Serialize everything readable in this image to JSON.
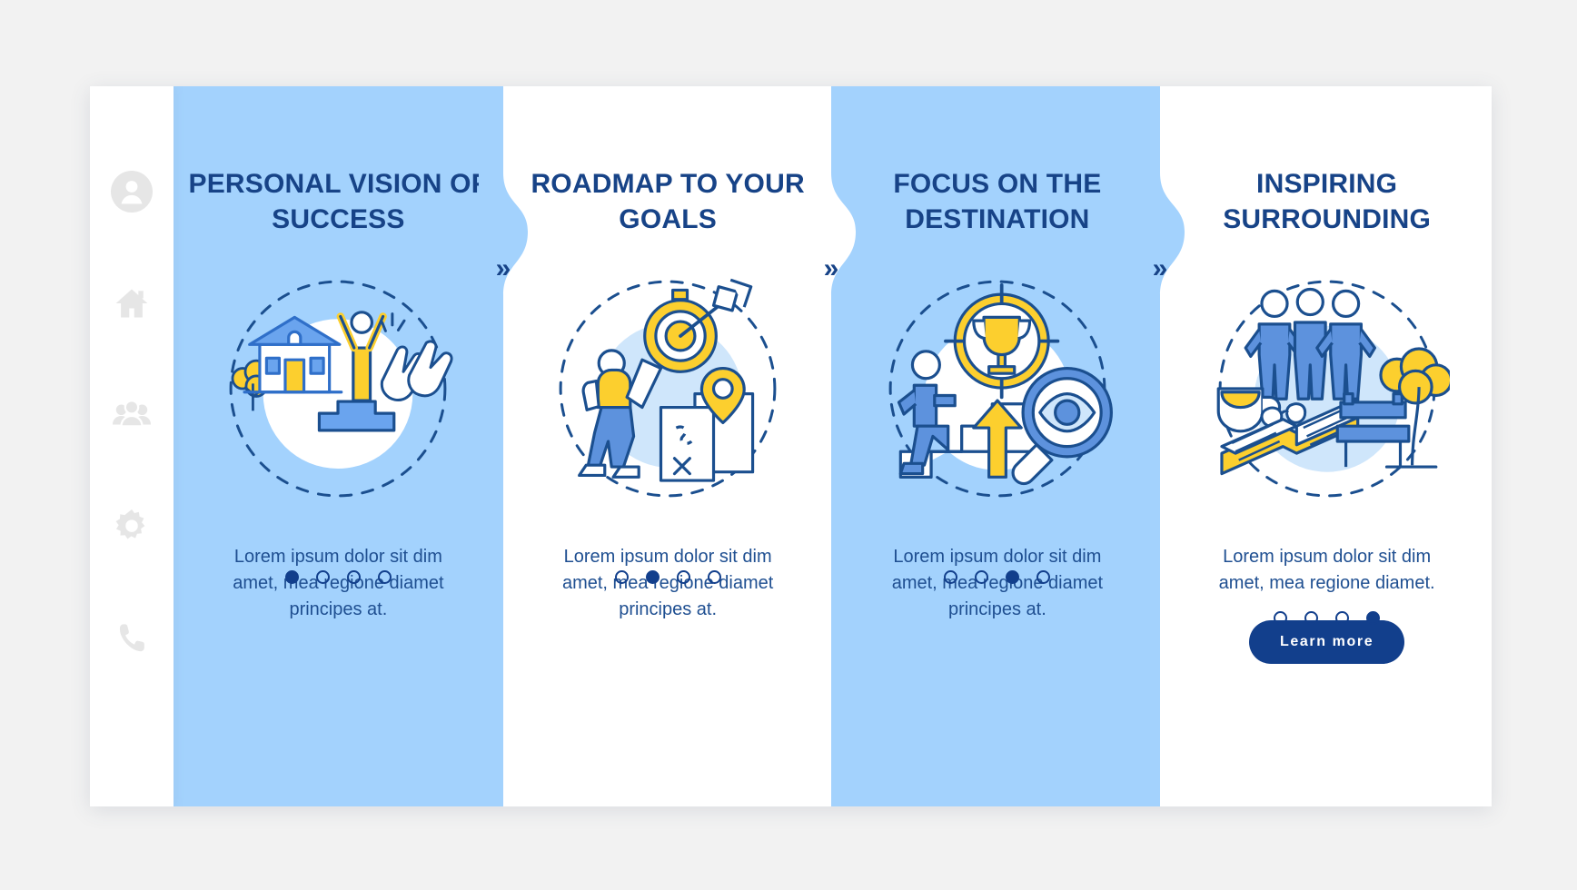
{
  "sidebar": {
    "items": [
      {
        "icon": "user-circle-icon",
        "name": "profile"
      },
      {
        "icon": "home-icon",
        "name": "home"
      },
      {
        "icon": "people-group-icon",
        "name": "community"
      },
      {
        "icon": "gear-icon",
        "name": "settings"
      },
      {
        "icon": "phone-icon",
        "name": "contact"
      }
    ]
  },
  "colors": {
    "panel_blue": "#a3d2fd",
    "panel_white": "#ffffff",
    "title_navy": "#174387",
    "body_navy": "#1f4f91",
    "accent_yellow": "#fccf2e",
    "accent_blue": "#4a8fe0",
    "button_navy": "#123f8c",
    "page_background": "#f2f2f2"
  },
  "separator": {
    "glyph": "»",
    "count": 3
  },
  "panels": [
    {
      "title": "Personal Vision of Success",
      "body": "Lorem ipsum dolor sit dim amet, mea regione diamet principes at.",
      "illustration": "family-house-trophy-applause-illustration",
      "theme": "blue",
      "dots": [
        true,
        false,
        false,
        false
      ],
      "cta": null
    },
    {
      "title": "Roadmap to Your Goals",
      "body": "Lorem ipsum dolor sit dim amet, mea regione diamet principes at.",
      "illustration": "hiker-target-map-pin-illustration",
      "theme": "white",
      "dots": [
        false,
        true,
        false,
        false
      ],
      "cta": null
    },
    {
      "title": "Focus on the Destination",
      "body": "Lorem ipsum dolor sit dim amet, mea regione diamet principes at.",
      "illustration": "trophy-crosshair-stairs-magnifier-illustration",
      "theme": "blue",
      "dots": [
        false,
        false,
        true,
        false
      ],
      "cta": null
    },
    {
      "title": "Inspiring Surrounding",
      "body": "Lorem ipsum dolor sit dim amet, mea regione diamet.",
      "illustration": "people-book-bench-tree-illustration",
      "theme": "white",
      "dots": [
        false,
        false,
        false,
        true
      ],
      "cta": "Learn more"
    }
  ]
}
